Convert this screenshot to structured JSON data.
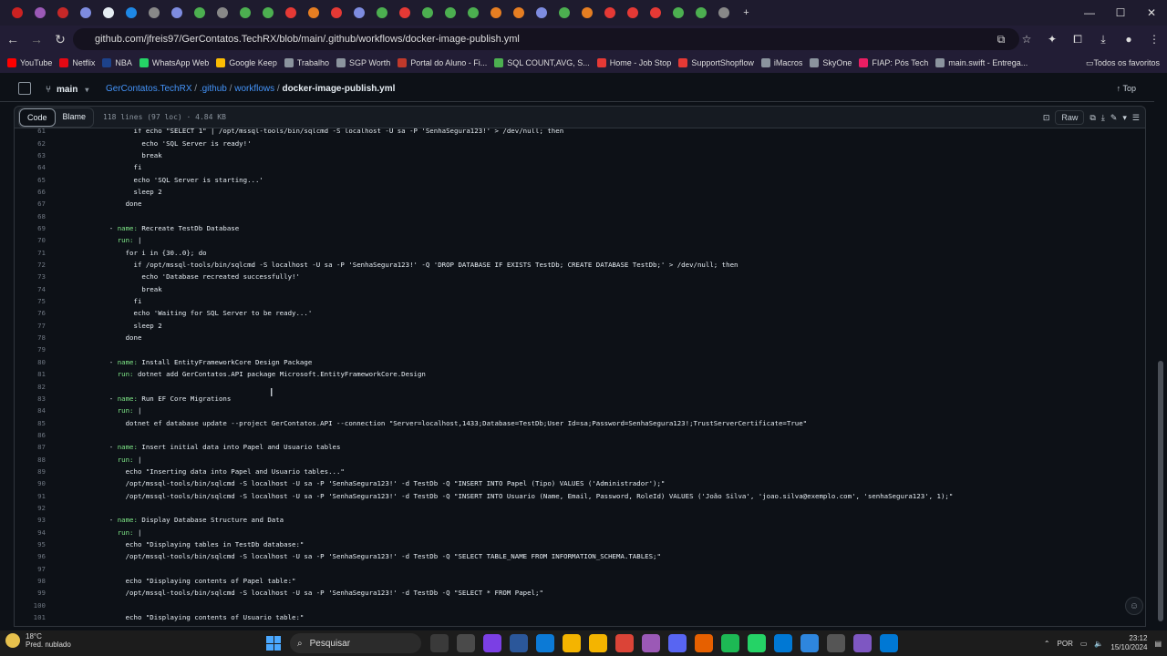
{
  "browser": {
    "url": "github.com/jfreis97/GerContatos.TechRX/blob/main/.github/workflows/docker-image-publish.yml",
    "tab_icons": [
      "#cc2222",
      "#9b59b6",
      "#c62828",
      "#7e8ce0",
      "#e6edf3",
      "#1e88e5",
      "#888888",
      "#7e8ce0",
      "#4caf50",
      "#888888",
      "#4caf50",
      "#4caf50",
      "#e53935",
      "#e67e22",
      "#e53935",
      "#7e8ce0",
      "#4caf50",
      "#e53935",
      "#4caf50",
      "#4caf50",
      "#4caf50",
      "#e67e22",
      "#e67e22",
      "#7e8ce0",
      "#4caf50",
      "#e67e22",
      "#e53935",
      "#e53935",
      "#e53935",
      "#4caf50",
      "#4caf50",
      "#888888"
    ],
    "bookmarks": [
      {
        "label": "YouTube",
        "color": "#ff0000"
      },
      {
        "label": "Netflix",
        "color": "#e50914"
      },
      {
        "label": "NBA",
        "color": "#1d428a"
      },
      {
        "label": "WhatsApp Web",
        "color": "#25d366"
      },
      {
        "label": "Google Keep",
        "color": "#fbbc04"
      },
      {
        "label": "Trabalho",
        "color": "#8b949e"
      },
      {
        "label": "SGP Worth",
        "color": "#8b949e"
      },
      {
        "label": "Portal do Aluno - Fi...",
        "color": "#c0392b"
      },
      {
        "label": "SQL COUNT,AVG, S...",
        "color": "#4caf50"
      },
      {
        "label": "Home - Job Stop",
        "color": "#e53935"
      },
      {
        "label": "SupportShopflow",
        "color": "#e53935"
      },
      {
        "label": "iMacros",
        "color": "#8b949e"
      },
      {
        "label": "SkyOne",
        "color": "#8b949e"
      },
      {
        "label": "FIAP: Pós Tech",
        "color": "#e91e63"
      },
      {
        "label": "main.swift - Entrega...",
        "color": "#8b949e"
      }
    ],
    "all_bookmarks_label": "Todos os favoritos"
  },
  "file_header": {
    "branch": "main",
    "repo": "GerContatos.TechRX",
    "dir1": ".github",
    "dir2": "workflows",
    "file": "docker-image-publish.yml",
    "top_label": "Top"
  },
  "toolbar": {
    "code_label": "Code",
    "blame_label": "Blame",
    "meta": "118 lines (97 loc) · 4.84 KB",
    "raw_label": "Raw"
  },
  "code_lines": [
    {
      "n": "61",
      "t": "          if echo \"SELECT 1\" | /opt/mssql-tools/bin/sqlcmd -S localhost -U sa -P 'SenhaSegura123!' > /dev/null; then"
    },
    {
      "n": "62",
      "t": "            echo 'SQL Server is ready!'"
    },
    {
      "n": "63",
      "t": "            break"
    },
    {
      "n": "64",
      "t": "          fi"
    },
    {
      "n": "65",
      "t": "          echo 'SQL Server is starting...'"
    },
    {
      "n": "66",
      "t": "          sleep 2"
    },
    {
      "n": "67",
      "t": "        done"
    },
    {
      "n": "68",
      "t": ""
    },
    {
      "n": "69",
      "t": "    - name: Recreate TestDb Database"
    },
    {
      "n": "70",
      "t": "      run: |"
    },
    {
      "n": "71",
      "t": "        for i in {30..0}; do"
    },
    {
      "n": "72",
      "t": "          if /opt/mssql-tools/bin/sqlcmd -S localhost -U sa -P 'SenhaSegura123!' -Q 'DROP DATABASE IF EXISTS TestDb; CREATE DATABASE TestDb;' > /dev/null; then"
    },
    {
      "n": "73",
      "t": "            echo 'Database recreated successfully!'"
    },
    {
      "n": "74",
      "t": "            break"
    },
    {
      "n": "75",
      "t": "          fi"
    },
    {
      "n": "76",
      "t": "          echo 'Waiting for SQL Server to be ready...'"
    },
    {
      "n": "77",
      "t": "          sleep 2"
    },
    {
      "n": "78",
      "t": "        done"
    },
    {
      "n": "79",
      "t": ""
    },
    {
      "n": "80",
      "t": "    - name: Install EntityFrameworkCore Design Package"
    },
    {
      "n": "81",
      "t": "      run: dotnet add GerContatos.API package Microsoft.EntityFrameworkCore.Design"
    },
    {
      "n": "82",
      "t": ""
    },
    {
      "n": "83",
      "t": "    - name: Run EF Core Migrations"
    },
    {
      "n": "84",
      "t": "      run: |"
    },
    {
      "n": "85",
      "t": "        dotnet ef database update --project GerContatos.API --connection \"Server=localhost,1433;Database=TestDb;User Id=sa;Password=SenhaSegura123!;TrustServerCertificate=True\""
    },
    {
      "n": "86",
      "t": ""
    },
    {
      "n": "87",
      "t": "    - name: Insert initial data into Papel and Usuario tables"
    },
    {
      "n": "88",
      "t": "      run: |"
    },
    {
      "n": "89",
      "t": "        echo \"Inserting data into Papel and Usuario tables...\""
    },
    {
      "n": "90",
      "t": "        /opt/mssql-tools/bin/sqlcmd -S localhost -U sa -P 'SenhaSegura123!' -d TestDb -Q \"INSERT INTO Papel (Tipo) VALUES ('Administrador');\""
    },
    {
      "n": "91",
      "t": "        /opt/mssql-tools/bin/sqlcmd -S localhost -U sa -P 'SenhaSegura123!' -d TestDb -Q \"INSERT INTO Usuario (Name, Email, Password, RoleId) VALUES ('João Silva', 'joao.silva@exemplo.com', 'senhaSegura123', 1);\""
    },
    {
      "n": "92",
      "t": ""
    },
    {
      "n": "93",
      "t": "    - name: Display Database Structure and Data"
    },
    {
      "n": "94",
      "t": "      run: |"
    },
    {
      "n": "95",
      "t": "        echo \"Displaying tables in TestDb database:\""
    },
    {
      "n": "96",
      "t": "        /opt/mssql-tools/bin/sqlcmd -S localhost -U sa -P 'SenhaSegura123!' -d TestDb -Q \"SELECT TABLE_NAME FROM INFORMATION_SCHEMA.TABLES;\""
    },
    {
      "n": "97",
      "t": ""
    },
    {
      "n": "98",
      "t": "        echo \"Displaying contents of Papel table:\""
    },
    {
      "n": "99",
      "t": "        /opt/mssql-tools/bin/sqlcmd -S localhost -U sa -P 'SenhaSegura123!' -d TestDb -Q \"SELECT * FROM Papel;\""
    },
    {
      "n": "100",
      "t": ""
    },
    {
      "n": "101",
      "t": "        echo \"Displaying contents of Usuario table:\""
    }
  ],
  "taskbar": {
    "temp": "18°C",
    "weather": "Pred. nublado",
    "search_label": "Pesquisar",
    "lang": "POR",
    "time": "23:12",
    "date": "15/10/2024",
    "app_colors": [
      "#3a3a3a",
      "#4a4a4a",
      "#7b3fe4",
      "#2b579a",
      "#0c7ad6",
      "#f4b400",
      "#f4b400",
      "#db4437",
      "#9b59b6",
      "#5865f2",
      "#e66000",
      "#1db954",
      "#25d366",
      "#0078d4",
      "#2e86de",
      "#555555",
      "#7e57c2",
      "#0078d4"
    ]
  }
}
